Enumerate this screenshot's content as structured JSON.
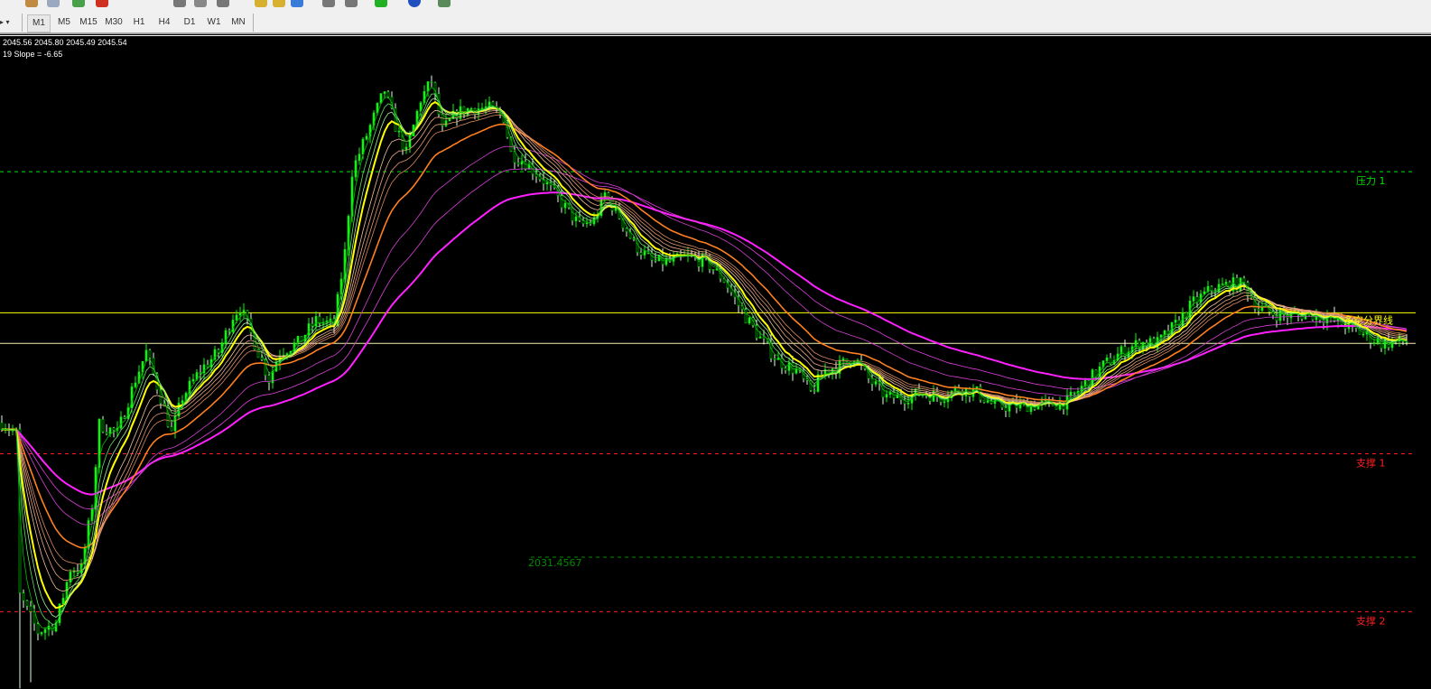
{
  "toolbar": {
    "timeframes": [
      "M1",
      "M5",
      "M15",
      "M30",
      "H1",
      "H4",
      "D1",
      "W1",
      "MN"
    ],
    "active_timeframe": "M1"
  },
  "info": {
    "ohlc": "2045.56 2045.80 2045.49 2045.54",
    "slope": "19 Slope = -6.65"
  },
  "colors": {
    "background": "#000000",
    "candle": "#00ff00",
    "resistance": "#00e000",
    "support": "#ff2020",
    "divider": "#ffff00",
    "level": "#008a00"
  },
  "chart_data": {
    "type": "candlestick",
    "ylim": [
      2022.86,
      2065.44
    ],
    "grid": false,
    "close_anchors": [
      [
        0,
        2040.24
      ],
      [
        4,
        2039.53
      ],
      [
        5,
        2028.93
      ],
      [
        10,
        2026.57
      ],
      [
        15,
        2027.16
      ],
      [
        19,
        2030.69
      ],
      [
        22,
        2030.69
      ],
      [
        25,
        2034.82
      ],
      [
        27,
        2040.12
      ],
      [
        32,
        2039.53
      ],
      [
        37,
        2043.06
      ],
      [
        40,
        2044.83
      ],
      [
        44,
        2041.89
      ],
      [
        47,
        2039.53
      ],
      [
        50,
        2041.89
      ],
      [
        55,
        2043.65
      ],
      [
        60,
        2044.83
      ],
      [
        64,
        2047.19
      ],
      [
        66,
        2047.78
      ],
      [
        70,
        2045.42
      ],
      [
        74,
        2043.06
      ],
      [
        77,
        2044.83
      ],
      [
        82,
        2045.42
      ],
      [
        87,
        2046.89
      ],
      [
        92,
        2046.6
      ],
      [
        95,
        2051.31
      ],
      [
        97,
        2056.61
      ],
      [
        100,
        2058.38
      ],
      [
        104,
        2060.73
      ],
      [
        106,
        2061.91
      ],
      [
        109,
        2059.56
      ],
      [
        112,
        2057.79
      ],
      [
        116,
        2061.32
      ],
      [
        119,
        2062.5
      ],
      [
        122,
        2059.26
      ],
      [
        126,
        2060.44
      ],
      [
        130,
        2060.73
      ],
      [
        135,
        2060.73
      ],
      [
        139,
        2060.14
      ],
      [
        141,
        2057.79
      ],
      [
        145,
        2057.2
      ],
      [
        150,
        2056.02
      ],
      [
        155,
        2054.55
      ],
      [
        160,
        2053.08
      ],
      [
        164,
        2053.37
      ],
      [
        167,
        2055.14
      ],
      [
        171,
        2053.67
      ],
      [
        175,
        2051.9
      ],
      [
        180,
        2050.72
      ],
      [
        185,
        2050.72
      ],
      [
        190,
        2051.01
      ],
      [
        195,
        2050.72
      ],
      [
        200,
        2049.54
      ],
      [
        205,
        2047.48
      ],
      [
        210,
        2045.71
      ],
      [
        215,
        2044.24
      ],
      [
        220,
        2043.65
      ],
      [
        224,
        2042.18
      ],
      [
        228,
        2043.65
      ],
      [
        232,
        2043.95
      ],
      [
        236,
        2044.54
      ],
      [
        240,
        2043.06
      ],
      [
        245,
        2041.89
      ],
      [
        250,
        2041.89
      ],
      [
        255,
        2042.18
      ],
      [
        260,
        2041.89
      ],
      [
        265,
        2042.47
      ],
      [
        270,
        2042.18
      ],
      [
        275,
        2041.3
      ],
      [
        280,
        2041.3
      ],
      [
        285,
        2041.41
      ],
      [
        290,
        2041.41
      ],
      [
        295,
        2041.59
      ],
      [
        300,
        2042.77
      ],
      [
        305,
        2043.95
      ],
      [
        310,
        2044.83
      ],
      [
        315,
        2045.42
      ],
      [
        320,
        2045.42
      ],
      [
        325,
        2046.6
      ],
      [
        330,
        2048.07
      ],
      [
        335,
        2048.95
      ],
      [
        340,
        2049.25
      ],
      [
        344,
        2049.25
      ],
      [
        348,
        2047.66
      ],
      [
        352,
        2047.36
      ],
      [
        357,
        2047.19
      ],
      [
        362,
        2047.36
      ],
      [
        367,
        2047.07
      ],
      [
        372,
        2046.6
      ],
      [
        377,
        2046.01
      ],
      [
        382,
        2045.42
      ],
      [
        389,
        2045.54
      ]
    ],
    "moving_averages": [
      {
        "period": 3,
        "color": "#00c000",
        "width": 0.8
      },
      {
        "period": 5,
        "color": "#60e060",
        "width": 0.8
      },
      {
        "period": 7,
        "color": "#a0f0a0",
        "width": 0.8
      },
      {
        "period": 9,
        "color": "#ffff00",
        "width": 2
      },
      {
        "period": 13,
        "color": "#f0c0a0",
        "width": 0.8
      },
      {
        "period": 16,
        "color": "#e8a888",
        "width": 0.8
      },
      {
        "period": 19,
        "color": "#e09870",
        "width": 0.8
      },
      {
        "period": 22,
        "color": "#d88860",
        "width": 0.8
      },
      {
        "period": 30,
        "color": "#ff8020",
        "width": 1.6
      },
      {
        "period": 45,
        "color": "#d040d0",
        "width": 0.8
      },
      {
        "period": 60,
        "color": "#e040e0",
        "width": 0.8
      },
      {
        "period": 80,
        "color": "#ff20ff",
        "width": 2
      }
    ],
    "levels": [
      {
        "name": "resistance-1",
        "price": 2056.6,
        "label": "压力 1",
        "color": "#00e000",
        "style": "dashed",
        "start_fraction": 0
      },
      {
        "name": "long-short-divider",
        "price": 2047.4,
        "label": "多空分界线",
        "color": "#ffff00",
        "style": "solid",
        "start_fraction": 0
      },
      {
        "name": "current-price-line",
        "price": 2045.4,
        "label": "",
        "color": "#f0f0b0",
        "style": "solid",
        "start_fraction": 0
      },
      {
        "name": "support-1",
        "price": 2038.2,
        "label": "支撑 1",
        "color": "#ff2020",
        "style": "dashed",
        "start_fraction": 0
      },
      {
        "name": "level-2031",
        "price": 2031.4567,
        "label": "2031.4567",
        "color": "#008a00",
        "style": "dashed",
        "start_fraction": 0.375
      },
      {
        "name": "support-2",
        "price": 2027.9,
        "label": "支撑 2",
        "color": "#ff2020",
        "style": "dashed",
        "start_fraction": 0
      }
    ],
    "bars": 390
  }
}
